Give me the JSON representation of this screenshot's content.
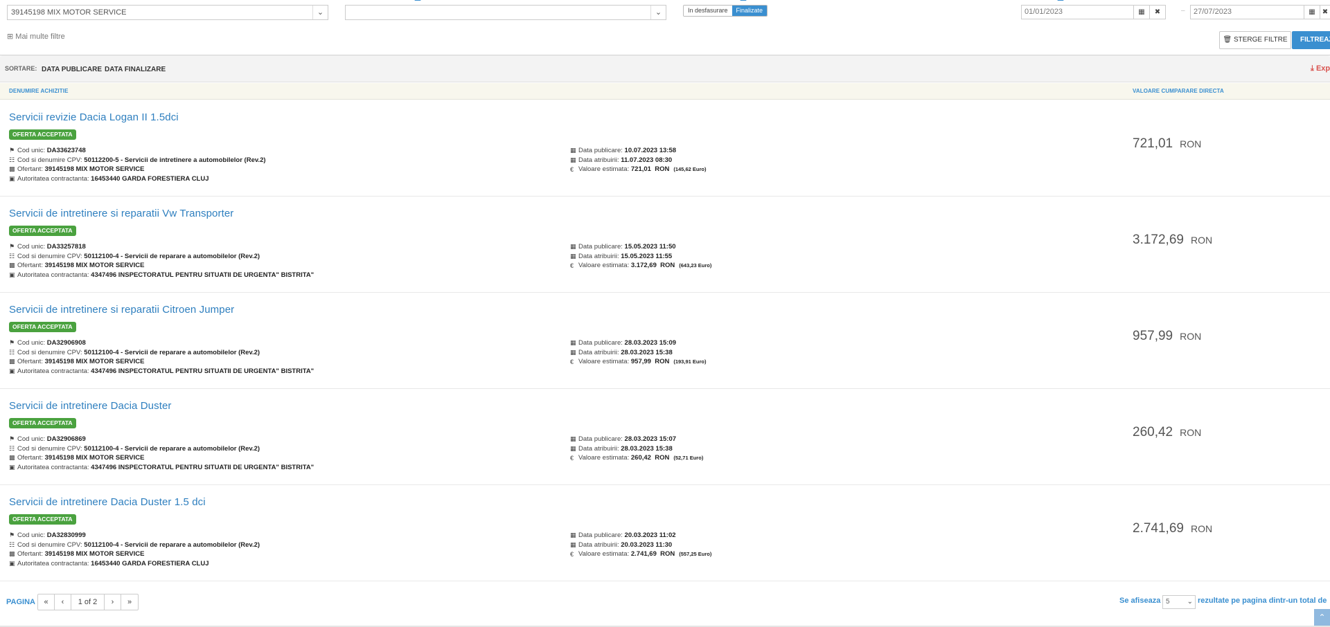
{
  "filters": {
    "supplier_value": "39145198 MIX MOTOR SERVICE",
    "cpv_value": "",
    "status_options": [
      "In desfasurare",
      "Finalizate"
    ],
    "date_from": "01/01/2023",
    "date_to": "27/07/2023",
    "more_filters": "Mai multe filtre",
    "clear_label": "STERGE FILTRE",
    "filter_label": "FILTREAZA"
  },
  "sort": {
    "label": "SORTARE:",
    "options": [
      "DATA PUBLICARE",
      "DATA FINALIZARE"
    ],
    "export_label": "Exp"
  },
  "table": {
    "col_name": "DENUMIRE ACHIZITIE",
    "col_value": "VALOARE CUMPARARE DIRECTA"
  },
  "labels": {
    "cod_unic": "Cod unic:",
    "cpv": "Cod si denumire CPV:",
    "ofertant": "Ofertant:",
    "autoritatea": "Autoritatea contractanta:",
    "data_publicare": "Data publicare:",
    "data_atribuirii": "Data atribuirii:",
    "valoare_estimata": "Valoare estimata:",
    "currency": "RON",
    "euro": "Euro"
  },
  "rows": [
    {
      "title": "Servicii revizie Dacia Logan II 1.5dci",
      "badge": "OFERTA ACCEPTATA",
      "cod": "DA33623748",
      "cpv": "50112200-5 - Servicii de intretinere a automobilelor (Rev.2)",
      "ofertant": "39145198 MIX MOTOR SERVICE",
      "autoritatea": "16453440 GARDA FORESTIERA CLUJ",
      "data_publicare": "10.07.2023 13:58",
      "data_atribuirii": "11.07.2023 08:30",
      "valoare": "721,01",
      "euro": "(145,62",
      "price": "721,01"
    },
    {
      "title": "Servicii de intretinere si reparatii Vw Transporter",
      "badge": "OFERTA ACCEPTATA",
      "cod": "DA33257818",
      "cpv": "50112100-4 - Servicii de reparare a automobilelor (Rev.2)",
      "ofertant": "39145198 MIX MOTOR SERVICE",
      "autoritatea": "4347496 INSPECTORATUL PENTRU SITUATII DE URGENTA\" BISTRITA\"",
      "data_publicare": "15.05.2023 11:50",
      "data_atribuirii": "15.05.2023 11:55",
      "valoare": "3.172,69",
      "euro": "(643,23",
      "price": "3.172,69"
    },
    {
      "title": "Servicii de intretinere si reparatii Citroen Jumper",
      "badge": "OFERTA ACCEPTATA",
      "cod": "DA32906908",
      "cpv": "50112100-4 - Servicii de reparare a automobilelor (Rev.2)",
      "ofertant": "39145198 MIX MOTOR SERVICE",
      "autoritatea": "4347496 INSPECTORATUL PENTRU SITUATII DE URGENTA\" BISTRITA\"",
      "data_publicare": "28.03.2023 15:09",
      "data_atribuirii": "28.03.2023 15:38",
      "valoare": "957,99",
      "euro": "(193,91",
      "price": "957,99"
    },
    {
      "title": "Servicii de intretinere Dacia Duster",
      "badge": "OFERTA ACCEPTATA",
      "cod": "DA32906869",
      "cpv": "50112100-4 - Servicii de reparare a automobilelor (Rev.2)",
      "ofertant": "39145198 MIX MOTOR SERVICE",
      "autoritatea": "4347496 INSPECTORATUL PENTRU SITUATII DE URGENTA\" BISTRITA\"",
      "data_publicare": "28.03.2023 15:07",
      "data_atribuirii": "28.03.2023 15:38",
      "valoare": "260,42",
      "euro": "(52,71",
      "price": "260,42"
    },
    {
      "title": "Servicii de intretinere Dacia Duster 1.5 dci",
      "badge": "OFERTA ACCEPTATA",
      "cod": "DA32830999",
      "cpv": "50112100-4 - Servicii de reparare a automobilelor (Rev.2)",
      "ofertant": "39145198 MIX MOTOR SERVICE",
      "autoritatea": "16453440 GARDA FORESTIERA CLUJ",
      "data_publicare": "20.03.2023 11:02",
      "data_atribuirii": "20.03.2023 11:30",
      "valoare": "2.741,69",
      "euro": "(557,25",
      "price": "2.741,69"
    }
  ],
  "pager": {
    "label": "PAGINA",
    "first": "«",
    "prev": "‹",
    "current": "1 of 2",
    "next": "›",
    "last": "»",
    "showing_prefix": "Se afiseaza",
    "per_page": "5",
    "showing_suffix": "rezultate pe pagina dintr-un total de"
  },
  "colors": {
    "accent": "#3a8fd0",
    "badge": "#4aa23f",
    "export": "#d9534f"
  }
}
